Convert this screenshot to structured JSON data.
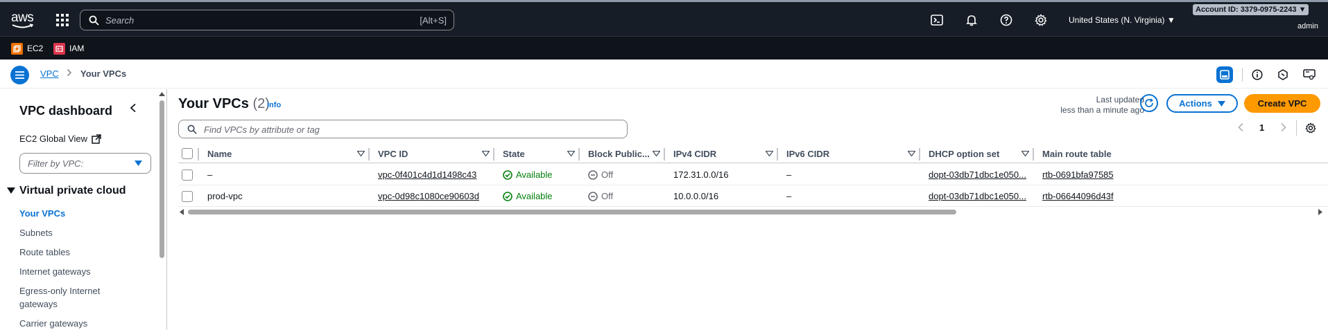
{
  "topnav": {
    "logo_text": "aws",
    "search_placeholder": "Search",
    "search_shortcut": "[Alt+S]",
    "region": "United States (N. Virginia) ▼",
    "account": "Account ID: 3379-0975-2243 ▼",
    "user": "admin"
  },
  "services": [
    {
      "label": "EC2",
      "color": "#ed7100"
    },
    {
      "label": "IAM",
      "color": "#dd344c"
    }
  ],
  "breadcrumb": {
    "root": "VPC",
    "current": "Your VPCs"
  },
  "sidenav": {
    "title": "VPC dashboard",
    "global_view": "EC2 Global View",
    "filter_placeholder": "Filter by VPC:",
    "section": "Virtual private cloud",
    "items": [
      {
        "label": "Your VPCs",
        "active": true
      },
      {
        "label": "Subnets"
      },
      {
        "label": "Route tables"
      },
      {
        "label": "Internet gateways"
      },
      {
        "label": "Egress-only Internet gateways"
      },
      {
        "label": "Carrier gateways"
      }
    ]
  },
  "main": {
    "title": "Your VPCs",
    "count": "(2)",
    "info": "Info",
    "last_updated_label": "Last updated",
    "last_updated_value": "less than a minute ago",
    "actions_label": "Actions",
    "create_label": "Create VPC",
    "search_placeholder": "Find VPCs by attribute or tag",
    "page": "1"
  },
  "table": {
    "columns": [
      "Name",
      "VPC ID",
      "State",
      "Block Public...",
      "IPv4 CIDR",
      "IPv6 CIDR",
      "DHCP option set",
      "Main route table"
    ],
    "rows": [
      {
        "name": "–",
        "vpc_id": "vpc-0f401c4d1d1498c43",
        "state": "Available",
        "block": "Off",
        "ipv4": "172.31.0.0/16",
        "ipv6": "–",
        "dhcp": "dopt-03db71dbc1e050...",
        "route": "rtb-0691bfa97585"
      },
      {
        "name": "prod-vpc",
        "vpc_id": "vpc-0d98c1080ce90603d",
        "state": "Available",
        "block": "Off",
        "ipv4": "10.0.0.0/16",
        "ipv6": "–",
        "dhcp": "dopt-03db71dbc1e050...",
        "route": "rtb-06644096d43f"
      }
    ]
  },
  "colors": {
    "accent": "#0972d3",
    "primary_button": "#ff9900",
    "status_available": "#037f0c"
  }
}
